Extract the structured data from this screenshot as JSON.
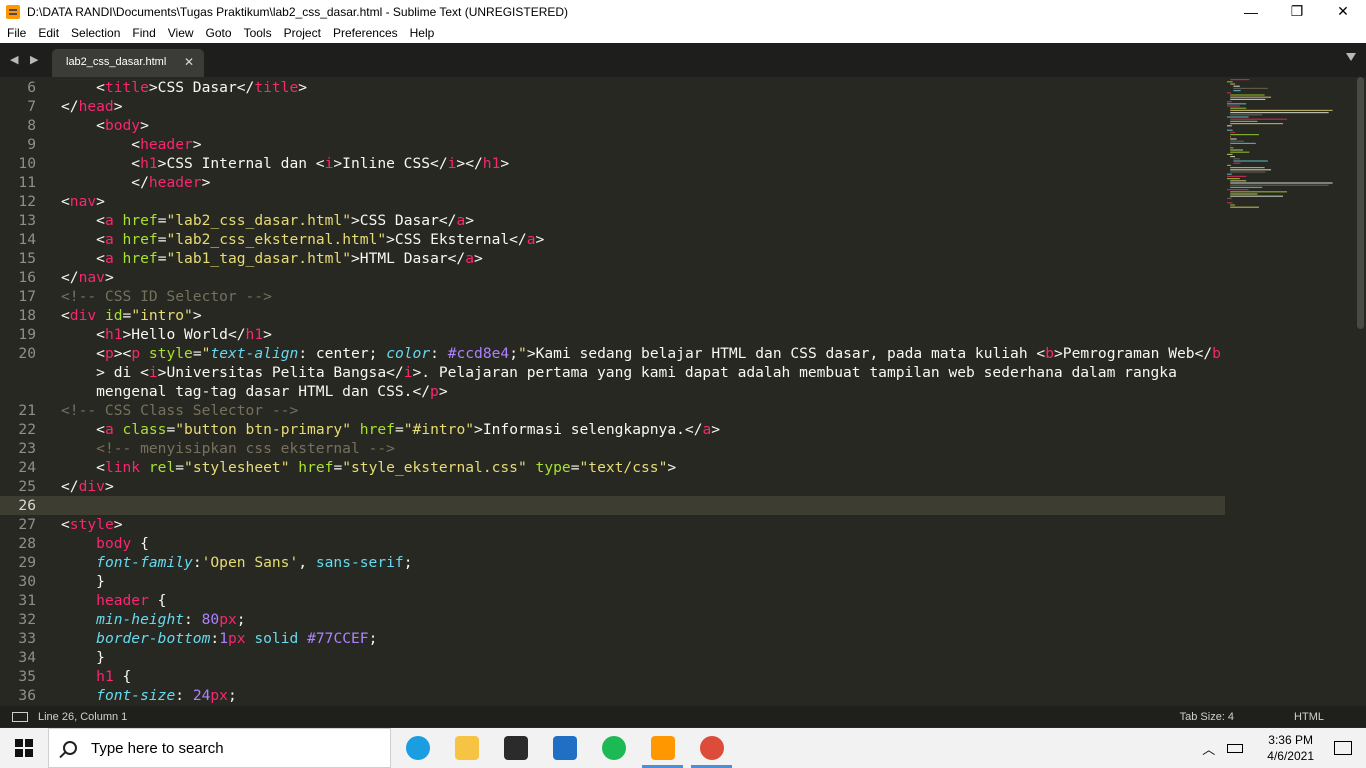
{
  "window": {
    "title": "D:\\DATA RANDI\\Documents\\Tugas Praktikum\\lab2_css_dasar.html - Sublime Text (UNREGISTERED)",
    "minimize_symbol": "—",
    "maximize_symbol": "❐",
    "close_symbol": "✕"
  },
  "menu": [
    "File",
    "Edit",
    "Selection",
    "Find",
    "View",
    "Goto",
    "Tools",
    "Project",
    "Preferences",
    "Help"
  ],
  "tabs": {
    "nav_symbol": "◀ ▶",
    "active": "lab2_css_dasar.html",
    "close_symbol": "✕"
  },
  "editor": {
    "active_line": 26,
    "lines": [
      {
        "n": "6",
        "code": "    <title>CSS Dasar</title>"
      },
      {
        "n": "7",
        "code": "</head>"
      },
      {
        "n": "8",
        "code": "    <body>"
      },
      {
        "n": "9",
        "code": "        <header>"
      },
      {
        "n": "10",
        "code": "        <h1>CSS Internal dan <i>Inline CSS</i></h1>"
      },
      {
        "n": "11",
        "code": "        </header>"
      },
      {
        "n": "12",
        "code": "<nav>"
      },
      {
        "n": "13",
        "code": "    <a href=\"lab2_css_dasar.html\">CSS Dasar</a>"
      },
      {
        "n": "14",
        "code": "    <a href=\"lab2_css_eksternal.html\">CSS Eksternal</a>"
      },
      {
        "n": "15",
        "code": "    <a href=\"lab1_tag_dasar.html\">HTML Dasar</a>"
      },
      {
        "n": "16",
        "code": "</nav>"
      },
      {
        "n": "17",
        "code": "<!-- CSS ID Selector -->"
      },
      {
        "n": "18",
        "code": "<div id=\"intro\">"
      },
      {
        "n": "19",
        "code": "    <h1>Hello World</h1>"
      },
      {
        "n": "20",
        "code": "    <p><p style=\"text-align: center; color: #ccd8e4;\">Kami sedang belajar HTML dan CSS dasar, pada mata kuliah <b>Pemrograman Web</b"
      },
      {
        "n": "",
        "code": "    > di <i>Universitas Pelita Bangsa</i>. Pelajaran pertama yang kami dapat adalah membuat tampilan web sederhana dalam rangka"
      },
      {
        "n": "",
        "code": "    mengenal tag-tag dasar HTML dan CSS.</p>"
      },
      {
        "n": "21",
        "code": "<!-- CSS Class Selector -->"
      },
      {
        "n": "22",
        "code": "    <a class=\"button btn-primary\" href=\"#intro\">Informasi selengkapnya.</a>"
      },
      {
        "n": "23",
        "code": "    <!-- menyisipkan css eksternal -->"
      },
      {
        "n": "24",
        "code": "    <link rel=\"stylesheet\" href=\"style_eksternal.css\" type=\"text/css\">"
      },
      {
        "n": "25",
        "code": "</div>"
      },
      {
        "n": "26",
        "code": ""
      },
      {
        "n": "27",
        "code": "<style>"
      },
      {
        "n": "28",
        "code": "    body {"
      },
      {
        "n": "29",
        "code": "    font-family:'Open Sans', sans-serif;"
      },
      {
        "n": "30",
        "code": "    }"
      },
      {
        "n": "31",
        "code": "    header {"
      },
      {
        "n": "32",
        "code": "    min-height: 80px;"
      },
      {
        "n": "33",
        "code": "    border-bottom:1px solid #77CCEF;"
      },
      {
        "n": "34",
        "code": "    }"
      },
      {
        "n": "35",
        "code": "    h1 {"
      },
      {
        "n": "36",
        "code": "    font-size: 24px;"
      }
    ]
  },
  "status": {
    "position": "Line 26, Column 1",
    "tab_size": "Tab Size: 4",
    "syntax": "HTML"
  },
  "taskbar": {
    "search_placeholder": "Type here to search",
    "apps": [
      {
        "name": "edge-icon",
        "color": "#1b9de2"
      },
      {
        "name": "file-explorer-icon",
        "color": "#f6c343"
      },
      {
        "name": "store-icon",
        "color": "#2b2b2b"
      },
      {
        "name": "mail-icon",
        "color": "#1f6fc5"
      },
      {
        "name": "spotify-icon",
        "color": "#1db954"
      },
      {
        "name": "sublime-text-icon",
        "color": "#ff9800"
      },
      {
        "name": "chrome-icon",
        "color": "#dd4b39"
      }
    ],
    "time": "3:36 PM",
    "date": "4/6/2021"
  },
  "colors": {
    "editor_bg": "#272822",
    "tag": "#f92672",
    "attribute": "#a6e22e",
    "string": "#e6db74",
    "comment": "#75715e",
    "number": "#ae81ff",
    "property": "#66d9ef"
  }
}
